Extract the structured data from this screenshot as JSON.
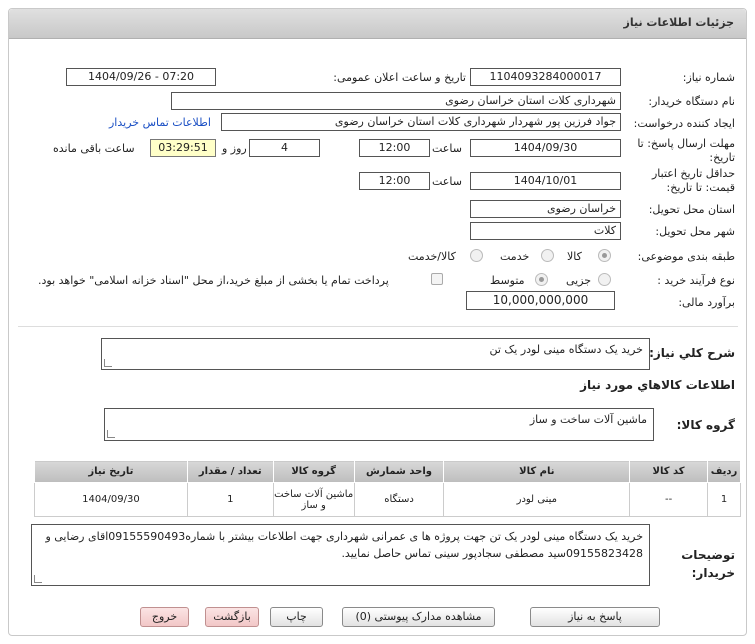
{
  "header": {
    "title": "جزئیات اطلاعات نیاز"
  },
  "fields": {
    "need_number_label": "شماره نیاز:",
    "need_number": "1104093284000017",
    "announce_label": "تاریخ و ساعت اعلان عمومی:",
    "announce_value": "1404/09/26 - 07:20",
    "buyer_org_label": "نام دستگاه خریدار:",
    "buyer_org": "شهرداری کلات استان خراسان رضوی",
    "creator_label": "ایجاد کننده درخواست:",
    "creator": "جواد فرزین پور شهردار شهرداری کلات استان خراسان رضوی",
    "contact_link": "اطلاعات تماس خریدار",
    "reply_deadline_label": "مهلت ارسال پاسخ: تا تاریخ:",
    "reply_date": "1404/09/30",
    "time_label": "ساعت",
    "reply_time": "12:00",
    "days_value": "4",
    "days_label": "روز و",
    "remaining_timer": "03:29:51",
    "remaining_label": "ساعت باقی مانده",
    "price_validity_label": "حداقل تاریخ اعتبار قیمت: تا تاریخ:",
    "validity_date": "1404/10/01",
    "validity_time_label": "ساعت",
    "validity_time": "12:00",
    "province_label": "استان محل تحویل:",
    "province": "خراسان رضوی",
    "city_label": "شهر محل تحویل:",
    "city": "کلات",
    "category_label": "طبقه بندی موضوعی:",
    "category_options": [
      "کالا",
      "خدمت",
      "کالا/خدمت"
    ],
    "process_label": "نوع فرآیند خرید :",
    "process_options": [
      "جزیی",
      "متوسط"
    ],
    "treasury_note": "پرداخت تمام یا بخشی از مبلغ خرید،از محل \"اسناد خزانه اسلامی\" خواهد بود.",
    "budget_label": "برآورد مالی:",
    "budget": "10,000,000,000"
  },
  "summary": {
    "label": "شرح کلي نياز:",
    "value": "خرید یک دستگاه مینی لودر یک تن"
  },
  "goods_section": {
    "title": "اطلاعات کالاهاي مورد نياز",
    "group_label": "گروه کالا:",
    "group_value": "ماشین آلات ساخت و ساز"
  },
  "table": {
    "headers": [
      "ردیف",
      "کد کالا",
      "نام کالا",
      "واحد شمارش",
      "گروه کالا",
      "تعداد / مقدار",
      "تاریخ نیاز"
    ],
    "rows": [
      [
        "1",
        "--",
        "مینی لودر",
        "دستگاه",
        "ماشین آلات ساخت و ساز",
        "1",
        "1404/09/30"
      ]
    ]
  },
  "notes": {
    "label": "توضیحات خریدار:",
    "value": "خرید یک دستگاه مینی لودر  یک تن جهت پروژه ها ی عمرانی شهرداری  جهت اطلاعات بیشتر با شماره09155590493اقای رضایی و 09155823428سید مصطفی سجادپور سینی تماس حاصل نمایید."
  },
  "buttons": {
    "reply": "پاسخ به نیاز",
    "docs": "مشاهده مدارک پیوستی (0)",
    "print": "چاپ",
    "back": "بازگشت",
    "exit": "خروج"
  },
  "colors": {
    "link": "#1a4fc4",
    "timer_bg": "#ffffc8",
    "exit_bg": "#f2c7c7"
  }
}
